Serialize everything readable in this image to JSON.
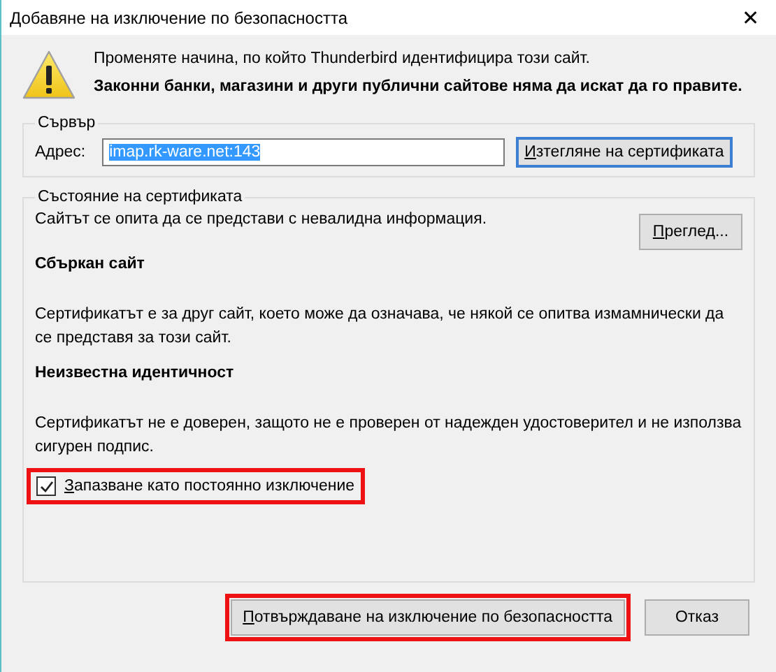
{
  "window": {
    "title": "Добавяне на изключение по безопасността",
    "close": "✕"
  },
  "warning": {
    "line": "Променяте начина, по който Thunderbird идентифицира този сайт.",
    "bold_line": "Законни банки, магазини и други публични сайтове няма да искат да го правите."
  },
  "server": {
    "legend": "Сървър",
    "address_label": "Адрес:",
    "address_value": "imap.rk-ware.net:143",
    "value_selected": true,
    "get_button": {
      "label": "Изтегляне на сертификата",
      "access_key": true,
      "focused": true
    }
  },
  "status": {
    "legend": "Състояние на сертификата",
    "summary": "Сайтът се опита да се представи с невалидна информация.",
    "view_button": {
      "label": "Преглед...",
      "access_key": true
    },
    "sections": [
      {
        "heading": "Сбъркан сайт",
        "text": "Сертификатът е за друг сайт, което може да означава, че някой се опитва измамнически да се представя за този сайт."
      },
      {
        "heading": "Неизвестна идентичност",
        "text": "Сертификатът не е доверен, защото не е проверен от надежден удостоверител и не използва сигурен подпис."
      }
    ],
    "permanent": {
      "label": "Запазване като постоянно изключение",
      "checked": true,
      "access_key": true,
      "highlighted": true
    }
  },
  "buttons": [
    {
      "label": "Потвърждаване на изключение по безопасността",
      "access_key": true,
      "highlighted": true
    },
    {
      "label": "Отказ",
      "access_key": false,
      "highlighted": false
    }
  ]
}
